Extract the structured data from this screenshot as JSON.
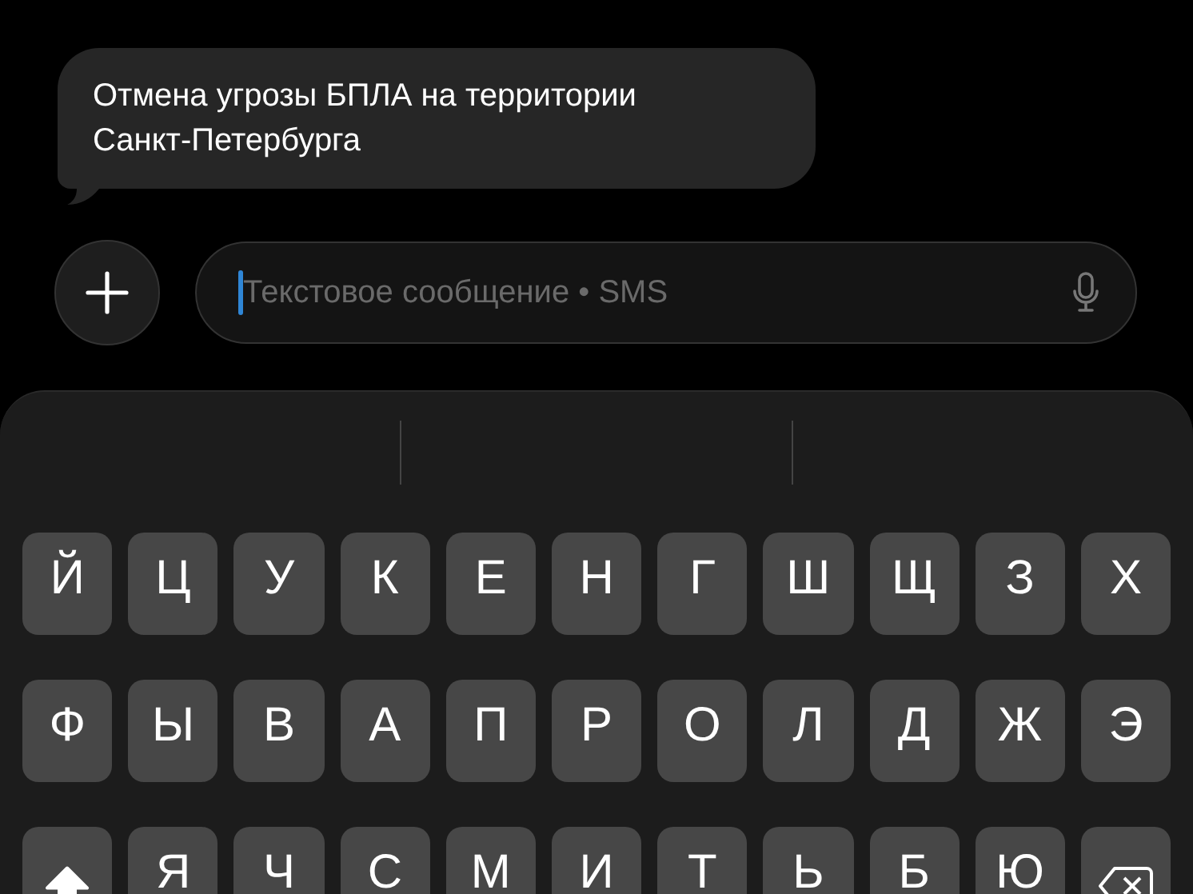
{
  "message": {
    "text": "Отмена угрозы БПЛА на территории Санкт-Петербурга"
  },
  "composer": {
    "placeholder": "Текстовое сообщение • SMS"
  },
  "keyboard": {
    "rows": [
      [
        {
          "kind": "letter",
          "label": "Й"
        },
        {
          "kind": "letter",
          "label": "Ц"
        },
        {
          "kind": "letter",
          "label": "У"
        },
        {
          "kind": "letter",
          "label": "К"
        },
        {
          "kind": "letter",
          "label": "Е"
        },
        {
          "kind": "letter",
          "label": "Н"
        },
        {
          "kind": "letter",
          "label": "Г"
        },
        {
          "kind": "letter",
          "label": "Ш"
        },
        {
          "kind": "letter",
          "label": "Щ"
        },
        {
          "kind": "letter",
          "label": "З"
        },
        {
          "kind": "letter",
          "label": "Х"
        }
      ],
      [
        {
          "kind": "letter",
          "label": "Ф"
        },
        {
          "kind": "letter",
          "label": "Ы"
        },
        {
          "kind": "letter",
          "label": "В"
        },
        {
          "kind": "letter",
          "label": "А"
        },
        {
          "kind": "letter",
          "label": "П"
        },
        {
          "kind": "letter",
          "label": "Р"
        },
        {
          "kind": "letter",
          "label": "О"
        },
        {
          "kind": "letter",
          "label": "Л"
        },
        {
          "kind": "letter",
          "label": "Д"
        },
        {
          "kind": "letter",
          "label": "Ж"
        },
        {
          "kind": "letter",
          "label": "Э"
        }
      ],
      [
        {
          "kind": "shift",
          "on": true
        },
        {
          "kind": "letter",
          "label": "Я"
        },
        {
          "kind": "letter",
          "label": "Ч"
        },
        {
          "kind": "letter",
          "label": "С"
        },
        {
          "kind": "letter",
          "label": "М"
        },
        {
          "kind": "letter",
          "label": "И"
        },
        {
          "kind": "letter",
          "label": "Т"
        },
        {
          "kind": "letter",
          "label": "Ь"
        },
        {
          "kind": "letter",
          "label": "Б"
        },
        {
          "kind": "letter",
          "label": "Ю"
        },
        {
          "kind": "backspace"
        }
      ]
    ]
  }
}
